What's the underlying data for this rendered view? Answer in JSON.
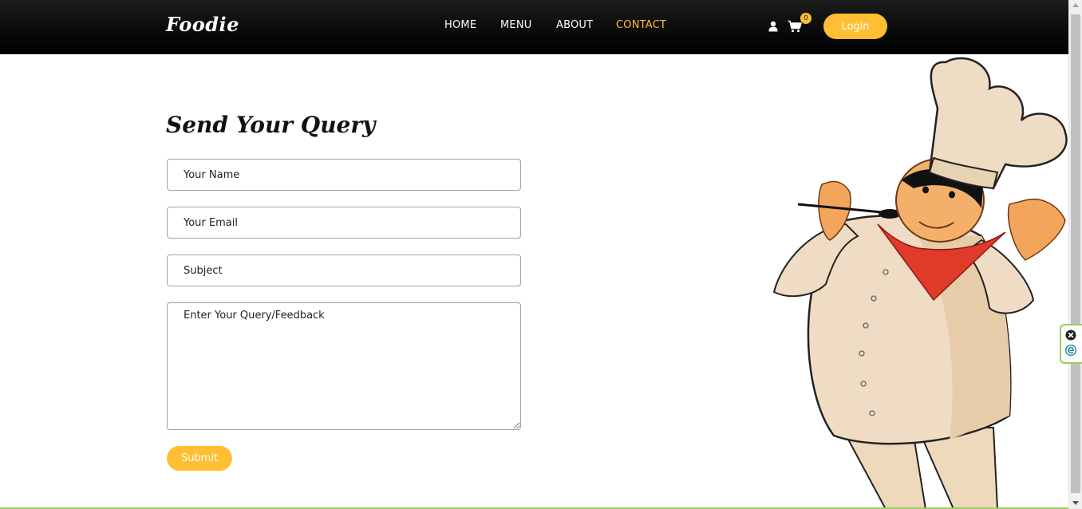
{
  "header": {
    "brand": "Foodie",
    "nav": [
      {
        "label": "HOME",
        "active": false
      },
      {
        "label": "MENU",
        "active": false
      },
      {
        "label": "ABOUT",
        "active": false
      },
      {
        "label": "CONTACT",
        "active": true
      }
    ],
    "cart_count": "0",
    "login_label": "Login",
    "icons": [
      "user-icon",
      "cart-icon"
    ]
  },
  "form": {
    "title": "Send Your Query",
    "name_placeholder": "Your Name",
    "email_placeholder": "Your Email",
    "subject_placeholder": "Subject",
    "query_placeholder": "Enter Your Query/Feedback",
    "submit_label": "Submit"
  },
  "illustration": {
    "subject": "chef-illustration"
  },
  "colors": {
    "accent": "#ffbe33",
    "header_bg": "#000000",
    "text": "#222222",
    "widget_border": "#9ccc65"
  }
}
